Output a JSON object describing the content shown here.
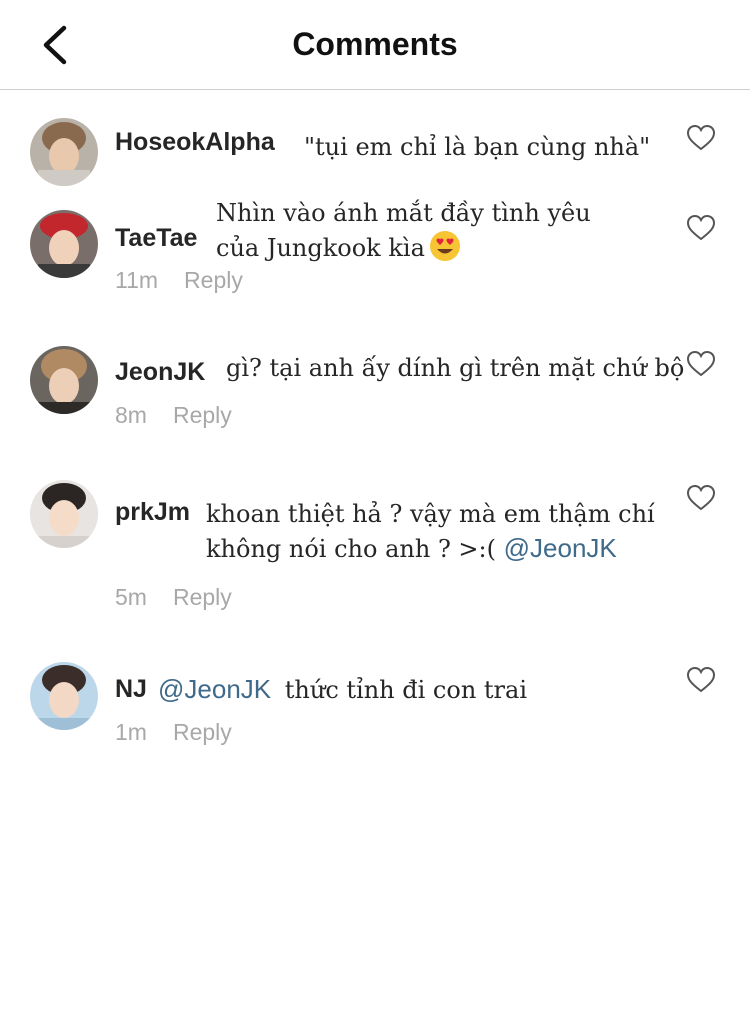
{
  "header": {
    "title": "Comments"
  },
  "icons": {
    "back": "chevron-left-icon",
    "like": "heart-outline-icon",
    "emoji": "heart-eyes-emoji"
  },
  "colors": {
    "mention": "#3f6a8a",
    "meta": "#a8a8a8",
    "divider": "#cfcfcf"
  },
  "comments": [
    {
      "user": "HoseokAlpha",
      "text": "\"tụi em chỉ là bạn cùng nhà\""
    },
    {
      "user": "TaeTae",
      "lines": [
        "Nhìn vào ánh mắt đầy tình yêu",
        "của Jungkook kìa"
      ],
      "time": "11m",
      "reply": "Reply"
    },
    {
      "user": "JeonJK",
      "text": "gì? tại anh ấy dính gì trên mặt chứ bộ",
      "time": "8m",
      "reply": "Reply"
    },
    {
      "user": "prkJm",
      "lines": [
        "khoan thiệt hả ? vậy mà em thậm chí",
        "không nói cho anh ? >:("
      ],
      "mention": "@JeonJK",
      "time": "5m",
      "reply": "Reply"
    },
    {
      "user": "NJ",
      "mention": "@JeonJK",
      "text": "thức tỉnh đi con trai",
      "time": "1m",
      "reply": "Reply"
    }
  ]
}
